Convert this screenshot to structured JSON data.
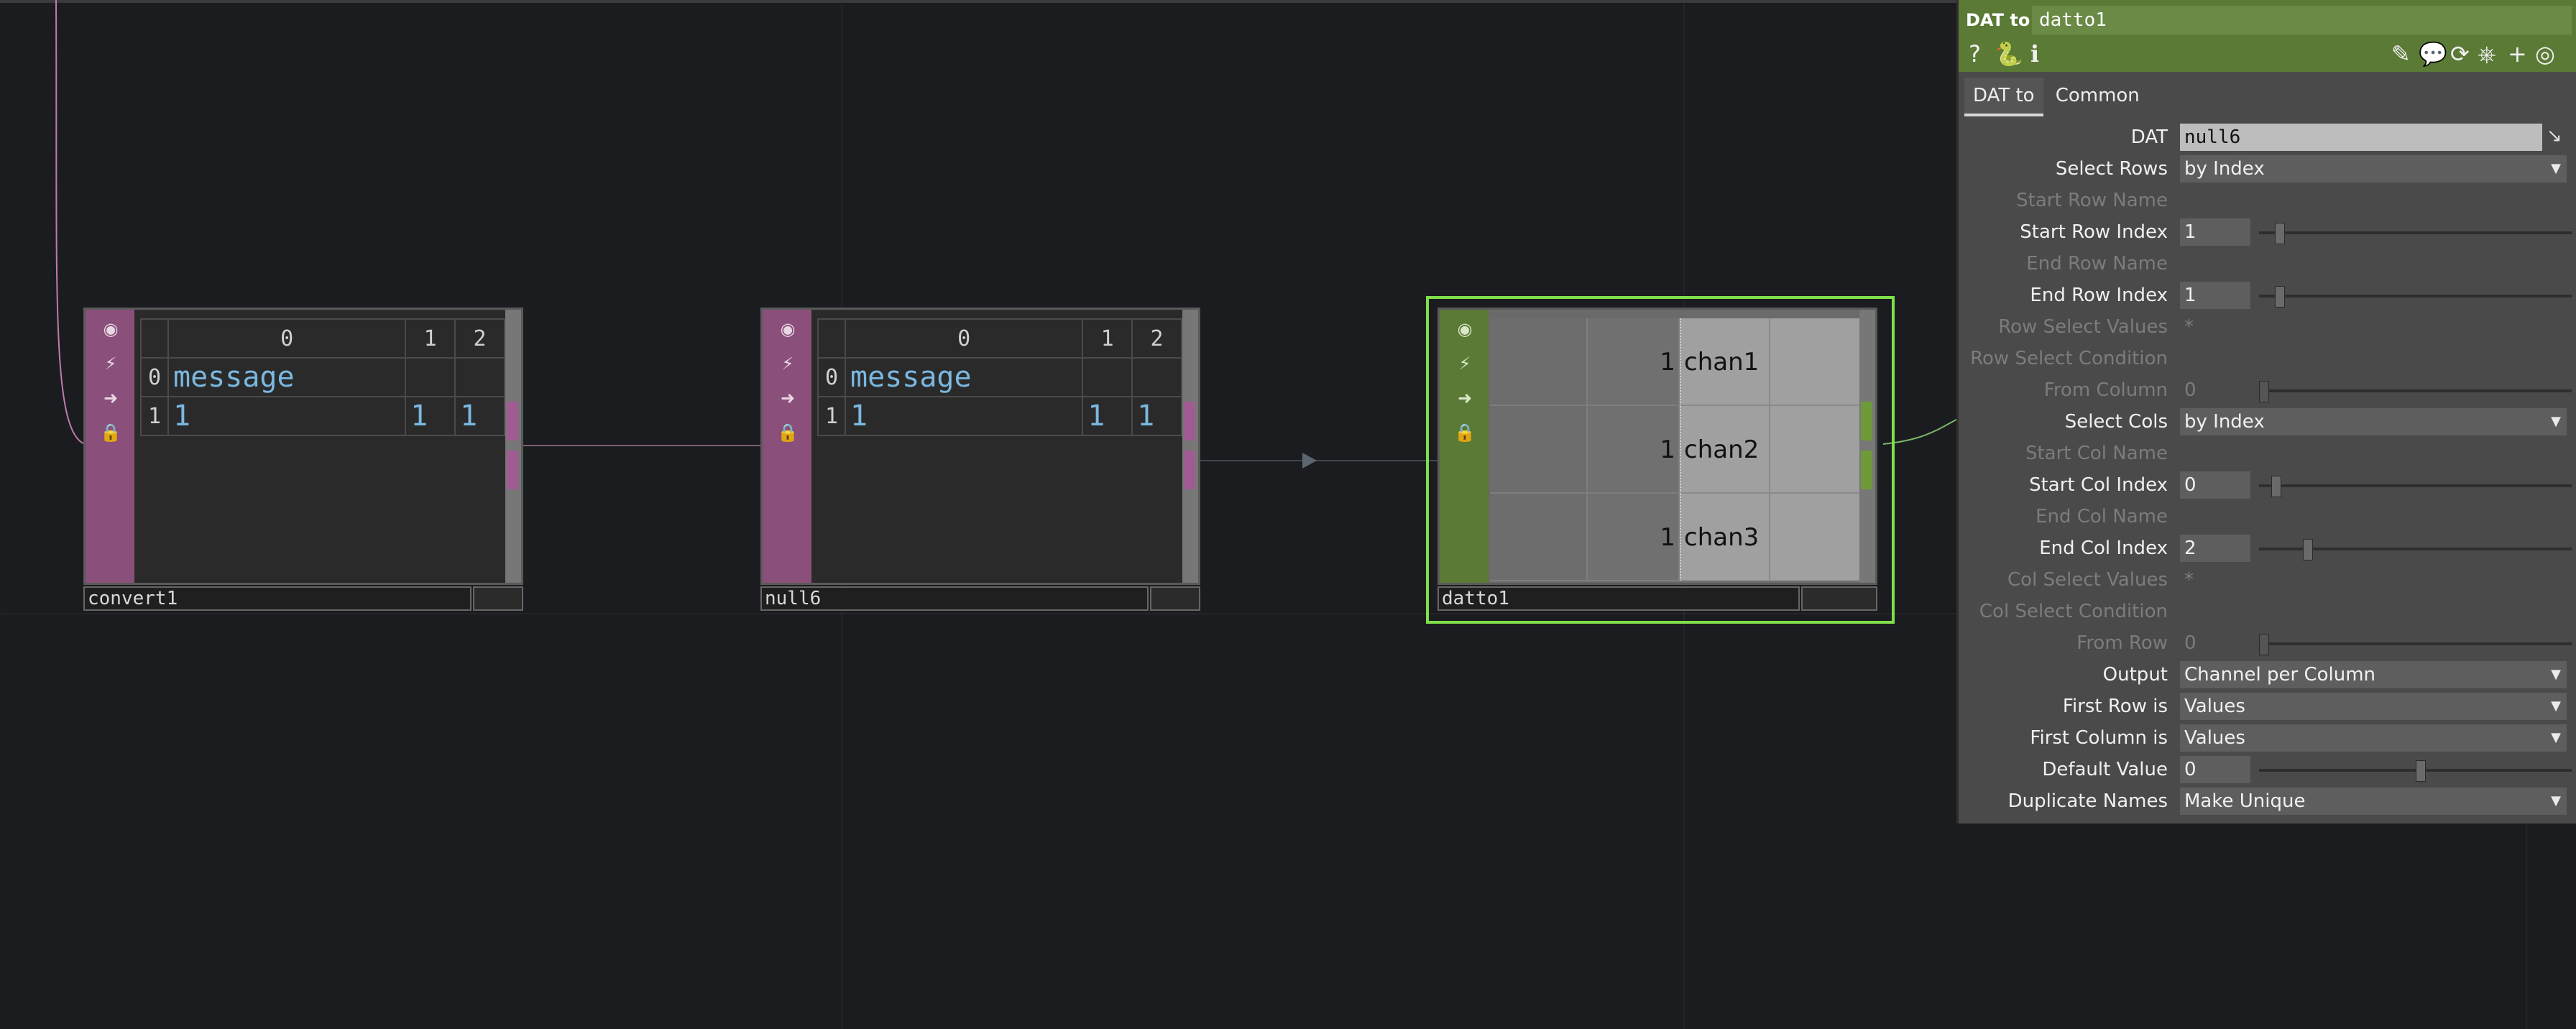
{
  "nodes": {
    "convert1": {
      "name": "convert1",
      "col_headers": [
        "0",
        "1",
        "2"
      ],
      "rows": [
        {
          "index": "0",
          "cells": [
            "message",
            "",
            ""
          ]
        },
        {
          "index": "1",
          "cells": [
            "1",
            "1",
            "1"
          ]
        }
      ]
    },
    "null6": {
      "name": "null6",
      "col_headers": [
        "0",
        "1",
        "2"
      ],
      "rows": [
        {
          "index": "0",
          "cells": [
            "message",
            "",
            ""
          ]
        },
        {
          "index": "1",
          "cells": [
            "1",
            "1",
            "1"
          ]
        }
      ]
    },
    "datto1": {
      "name": "datto1",
      "channels": [
        {
          "value": "1",
          "name": "chan1"
        },
        {
          "value": "1",
          "name": "chan2"
        },
        {
          "value": "1",
          "name": "chan3"
        }
      ]
    }
  },
  "panel": {
    "op_type": "DAT to",
    "op_name": "datto1",
    "tabs": [
      "DAT to",
      "Common"
    ],
    "params": {
      "dat": {
        "label": "DAT",
        "value": "null6"
      },
      "select_rows": {
        "label": "Select Rows",
        "value": "by Index"
      },
      "start_row_name": {
        "label": "Start Row Name"
      },
      "start_row_index": {
        "label": "Start Row Index",
        "value": "1",
        "level": 0.05
      },
      "end_row_name": {
        "label": "End Row  Name"
      },
      "end_row_index": {
        "label": "End Row Index",
        "value": "1",
        "level": 0.05
      },
      "row_select_values": {
        "label": "Row Select Values",
        "value": "*"
      },
      "row_select_condition": {
        "label": "Row Select Condition"
      },
      "from_column": {
        "label": "From Column",
        "value": "0",
        "level": 0
      },
      "select_cols": {
        "label": "Select Cols",
        "value": "by Index"
      },
      "start_col_name": {
        "label": "Start Col Name"
      },
      "start_col_index": {
        "label": "Start Col Index",
        "value": "0",
        "level": 0.04
      },
      "end_col_name": {
        "label": "End Col Name"
      },
      "end_col_index": {
        "label": "End Col Index",
        "value": "2",
        "level": 0.14
      },
      "col_select_values": {
        "label": "Col Select Values",
        "value": "*"
      },
      "col_select_condition": {
        "label": "Col Select Condition"
      },
      "from_row": {
        "label": "From Row",
        "value": "0",
        "level": 0
      },
      "output": {
        "label": "Output",
        "value": "Channel per Column"
      },
      "first_row_is": {
        "label": "First Row is",
        "value": "Values"
      },
      "first_column_is": {
        "label": "First Column is",
        "value": "Values"
      },
      "default_value": {
        "label": "Default Value",
        "value": "0",
        "level": 0.5
      },
      "duplicate_names": {
        "label": "Duplicate Names",
        "value": "Make Unique"
      }
    },
    "icons": [
      "help-icon",
      "python-help-icon",
      "info-icon",
      "pencil-icon",
      "comment-icon",
      "clone-icon",
      "python-icon",
      "add-icon",
      "target-icon"
    ]
  },
  "colors": {
    "dat_node": "#8a4f7a",
    "chop_node": "#5a7a35",
    "selection": "#7fe04a",
    "background": "#1b1c1f"
  }
}
